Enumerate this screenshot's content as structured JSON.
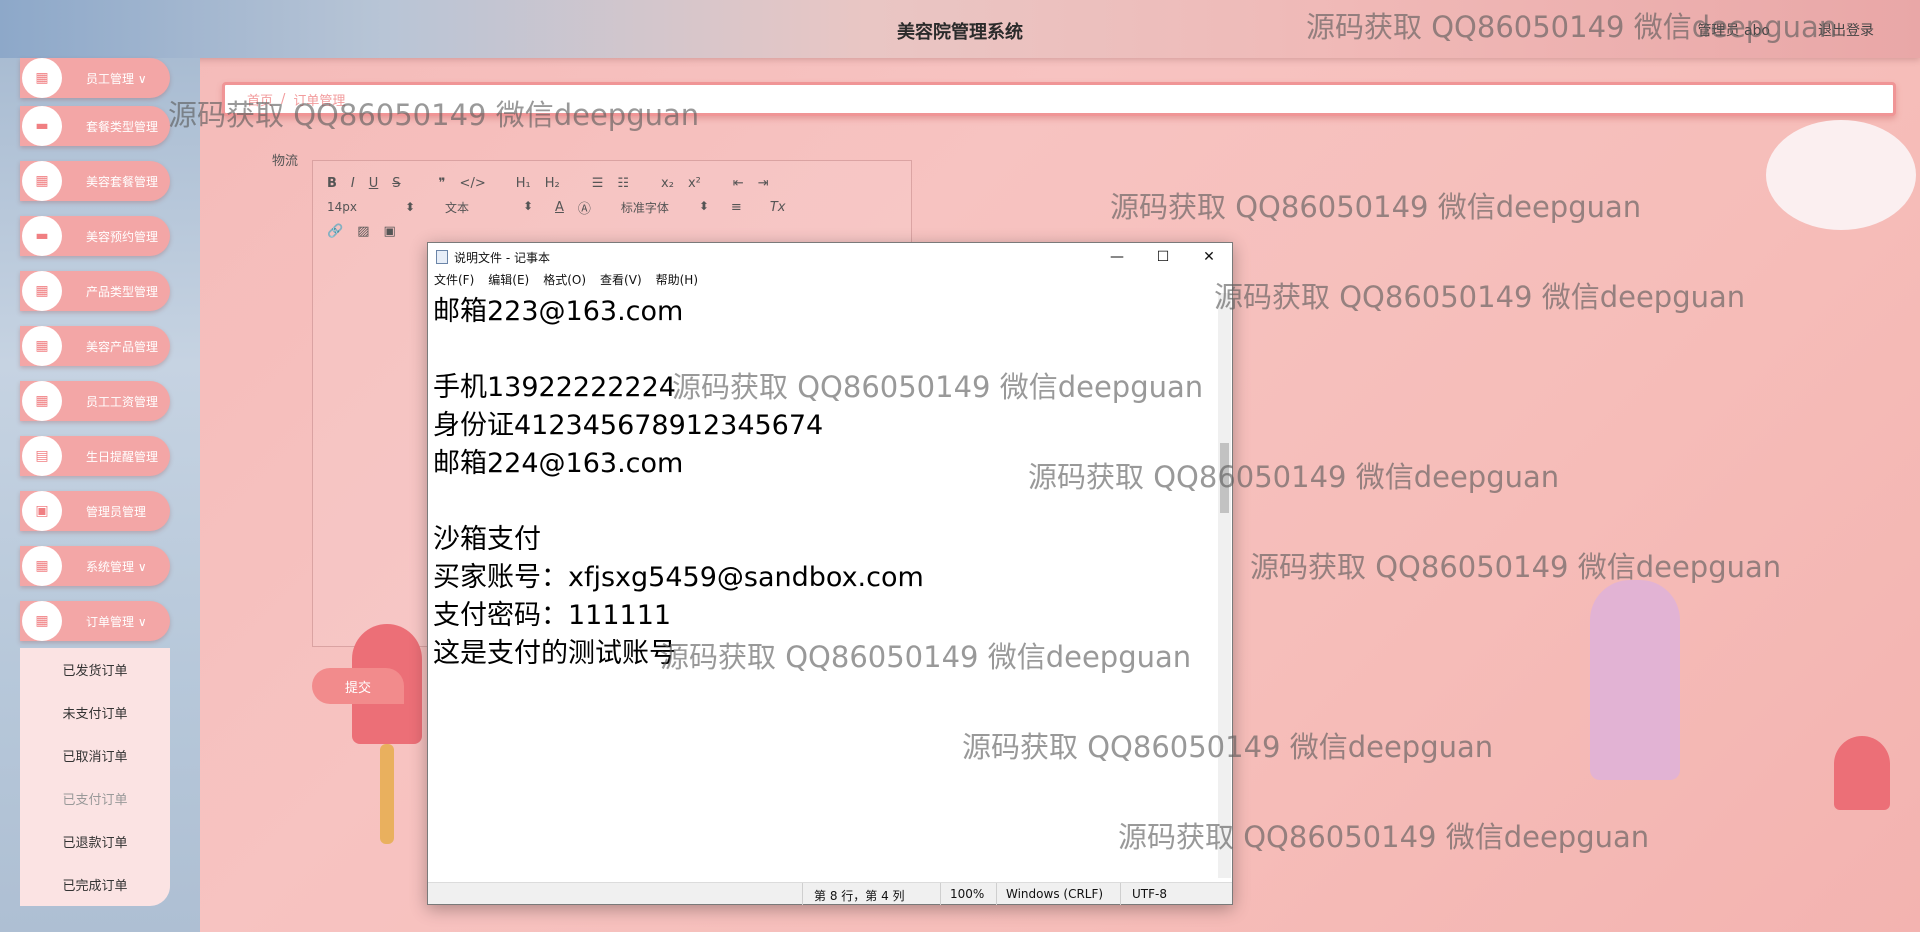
{
  "header": {
    "title": "美容院管理系统",
    "user_label": "管理员 abo",
    "logout_label": "退出登录"
  },
  "sidebar": {
    "items": [
      {
        "label": "员工管理 ∨"
      },
      {
        "label": "套餐类型管理"
      },
      {
        "label": "美容套餐管理"
      },
      {
        "label": "美容预约管理"
      },
      {
        "label": "产品类型管理"
      },
      {
        "label": "美容产品管理"
      },
      {
        "label": "员工工资管理"
      },
      {
        "label": "生日提醒管理"
      },
      {
        "label": "管理员管理"
      },
      {
        "label": "系统管理 ∨"
      },
      {
        "label": "订单管理 ∨"
      }
    ],
    "submenu": [
      {
        "label": "已发货订单"
      },
      {
        "label": "未支付订单"
      },
      {
        "label": "已取消订单"
      },
      {
        "label": "已支付订单"
      },
      {
        "label": "已退款订单"
      },
      {
        "label": "已完成订单"
      }
    ]
  },
  "breadcrumb": {
    "home": "首页",
    "current": "订单管理"
  },
  "form": {
    "field_label": "物流",
    "submit_label": "提交",
    "toolbar": {
      "size_value": "14px",
      "block_value": "文本",
      "font_value": "标准字体"
    }
  },
  "notepad": {
    "title": "说明文件 - 记事本",
    "menu": [
      "文件(F)",
      "编辑(E)",
      "格式(O)",
      "查看(V)",
      "帮助(H)"
    ],
    "content": "邮箱223@163.com\n\n手机13922222224\n身份证412345678912345674\n邮箱224@163.com\n\n沙箱支付\n买家账号：xfjsxg5459@sandbox.com\n支付密码：111111\n这是支付的测试账号",
    "status": {
      "position": "第 8 行，第 4 列",
      "zoom": "100%",
      "line_ending": "Windows (CRLF)",
      "encoding": "UTF-8"
    }
  },
  "watermark": "源码获取 QQ86050149 微信deepguan"
}
